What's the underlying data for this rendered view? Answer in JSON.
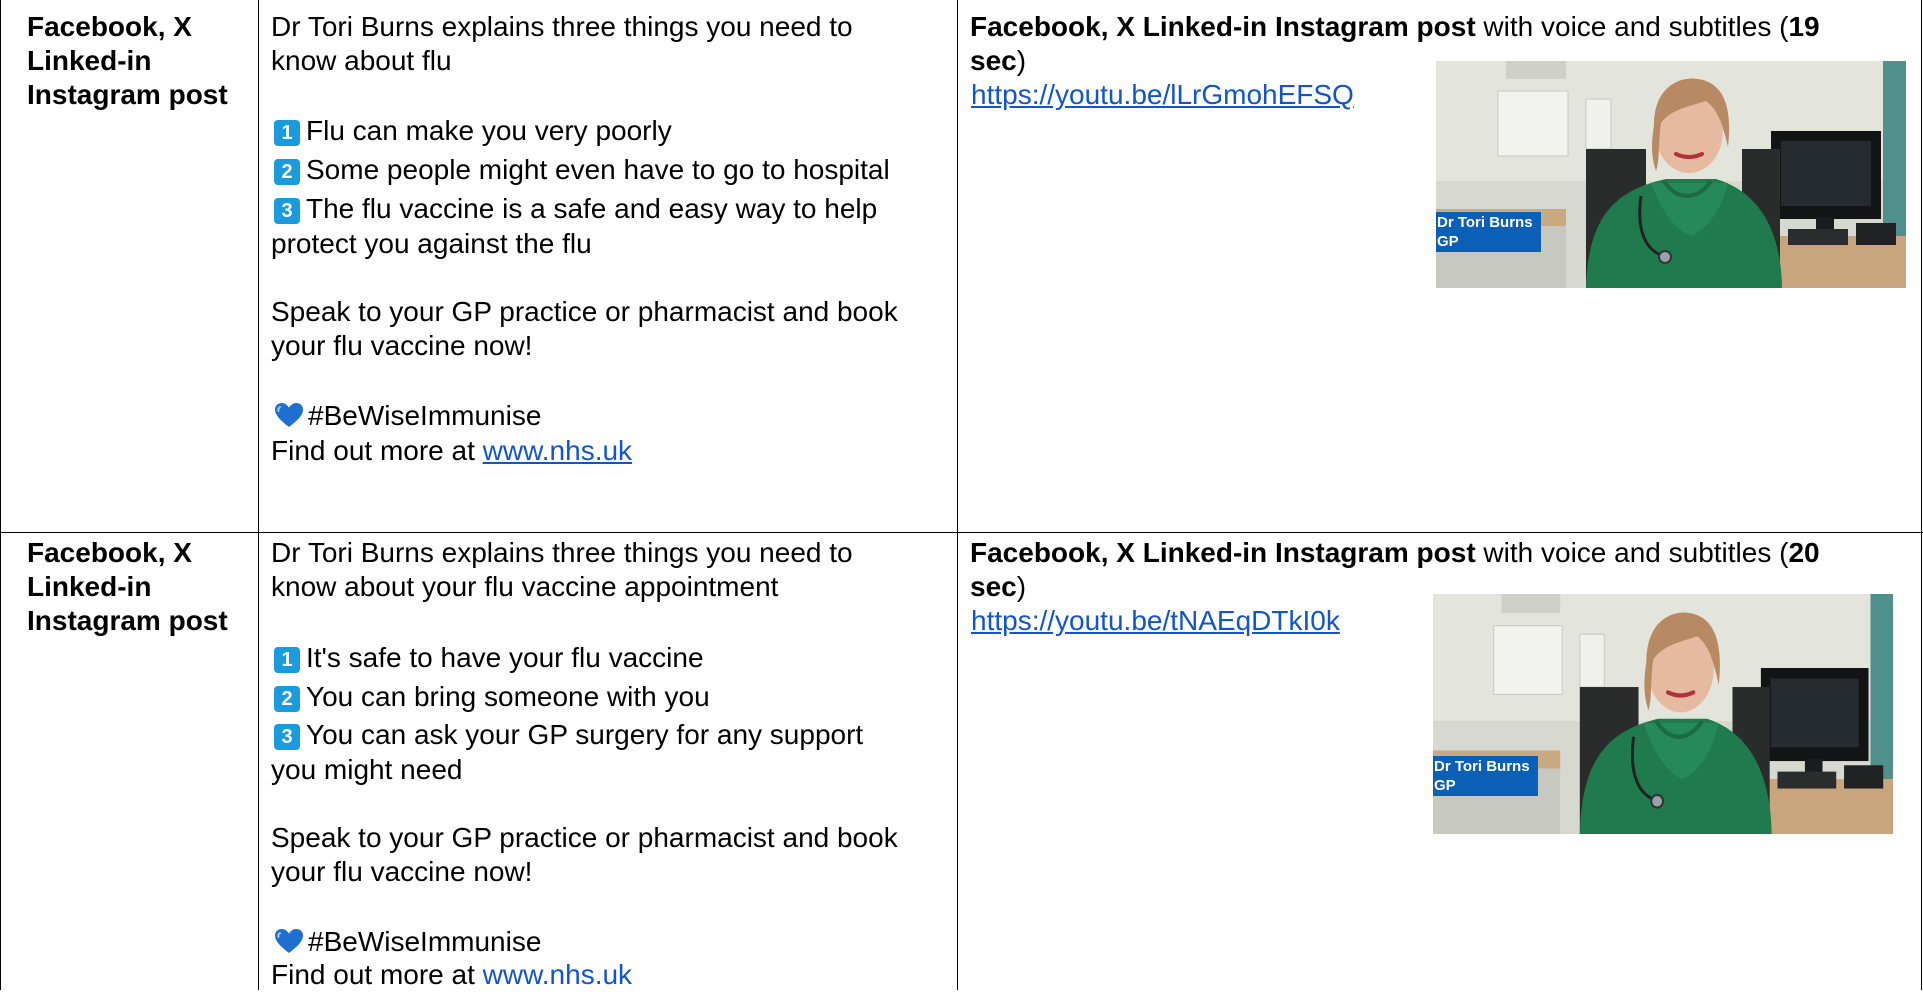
{
  "rows": [
    {
      "channel": [
        "Facebook, X",
        "Linked-in",
        "Instagram post"
      ],
      "intro": [
        "Dr Tori Burns explains three things you need to",
        "know about flu"
      ],
      "points": [
        {
          "n": "1",
          "text": "Flu can make you very poorly"
        },
        {
          "n": "2",
          "text": "Some people might even have to go to hospital"
        },
        {
          "n": "3",
          "text": "The flu vaccine is a safe and easy way to help",
          "cont": "protect you against the flu"
        }
      ],
      "cta": [
        "Speak to your GP practice or pharmacist and book",
        "your flu vaccine now!"
      ],
      "hashtag": "#BeWiseImmunise",
      "more_prefix": "Find out more at ",
      "more_link": "www.nhs.uk",
      "asset_bold": "Facebook, X Linked-in Instagram post",
      "asset_text": " with voice and subtitles (",
      "asset_duration": "19",
      "asset_sec": "sec",
      "asset_close": ")",
      "url": "https://youtu.be/lLrGmohEFSQ",
      "thumb_name": "Dr Tori Burns",
      "thumb_role": "GP"
    },
    {
      "channel": [
        "Facebook, X",
        "Linked-in",
        "Instagram post"
      ],
      "intro": [
        "Dr Tori Burns explains three things you need to",
        "know about your flu vaccine appointment"
      ],
      "points": [
        {
          "n": "1",
          "text": "It's safe to have your flu vaccine"
        },
        {
          "n": "2",
          "text": "You can bring someone with you"
        },
        {
          "n": "3",
          "text": "You can ask your GP surgery for any support",
          "cont": "you might need"
        }
      ],
      "cta": [
        "Speak to your GP practice or pharmacist and book",
        "your flu vaccine now!"
      ],
      "hashtag": "#BeWiseImmunise",
      "more_prefix": "Find out more at ",
      "more_link": "www.nhs.uk",
      "asset_bold": "Facebook, X Linked-in Instagram post",
      "asset_text": " with voice and subtitles (",
      "asset_duration": "20",
      "asset_sec": "sec",
      "asset_close": ")",
      "url": "https://youtu.be/tNAEqDTkI0k",
      "thumb_name": "Dr Tori Burns",
      "thumb_role": "GP"
    }
  ],
  "colors": {
    "link": "#1155cc",
    "number_badge": "#1a9bde",
    "heart": "#1f6fd1",
    "name_caption": "#0b5fb7"
  },
  "icons": {
    "number_badge": "keycap-number-icon",
    "heart": "blue-heart-icon",
    "thumbnail": "video-thumbnail"
  }
}
